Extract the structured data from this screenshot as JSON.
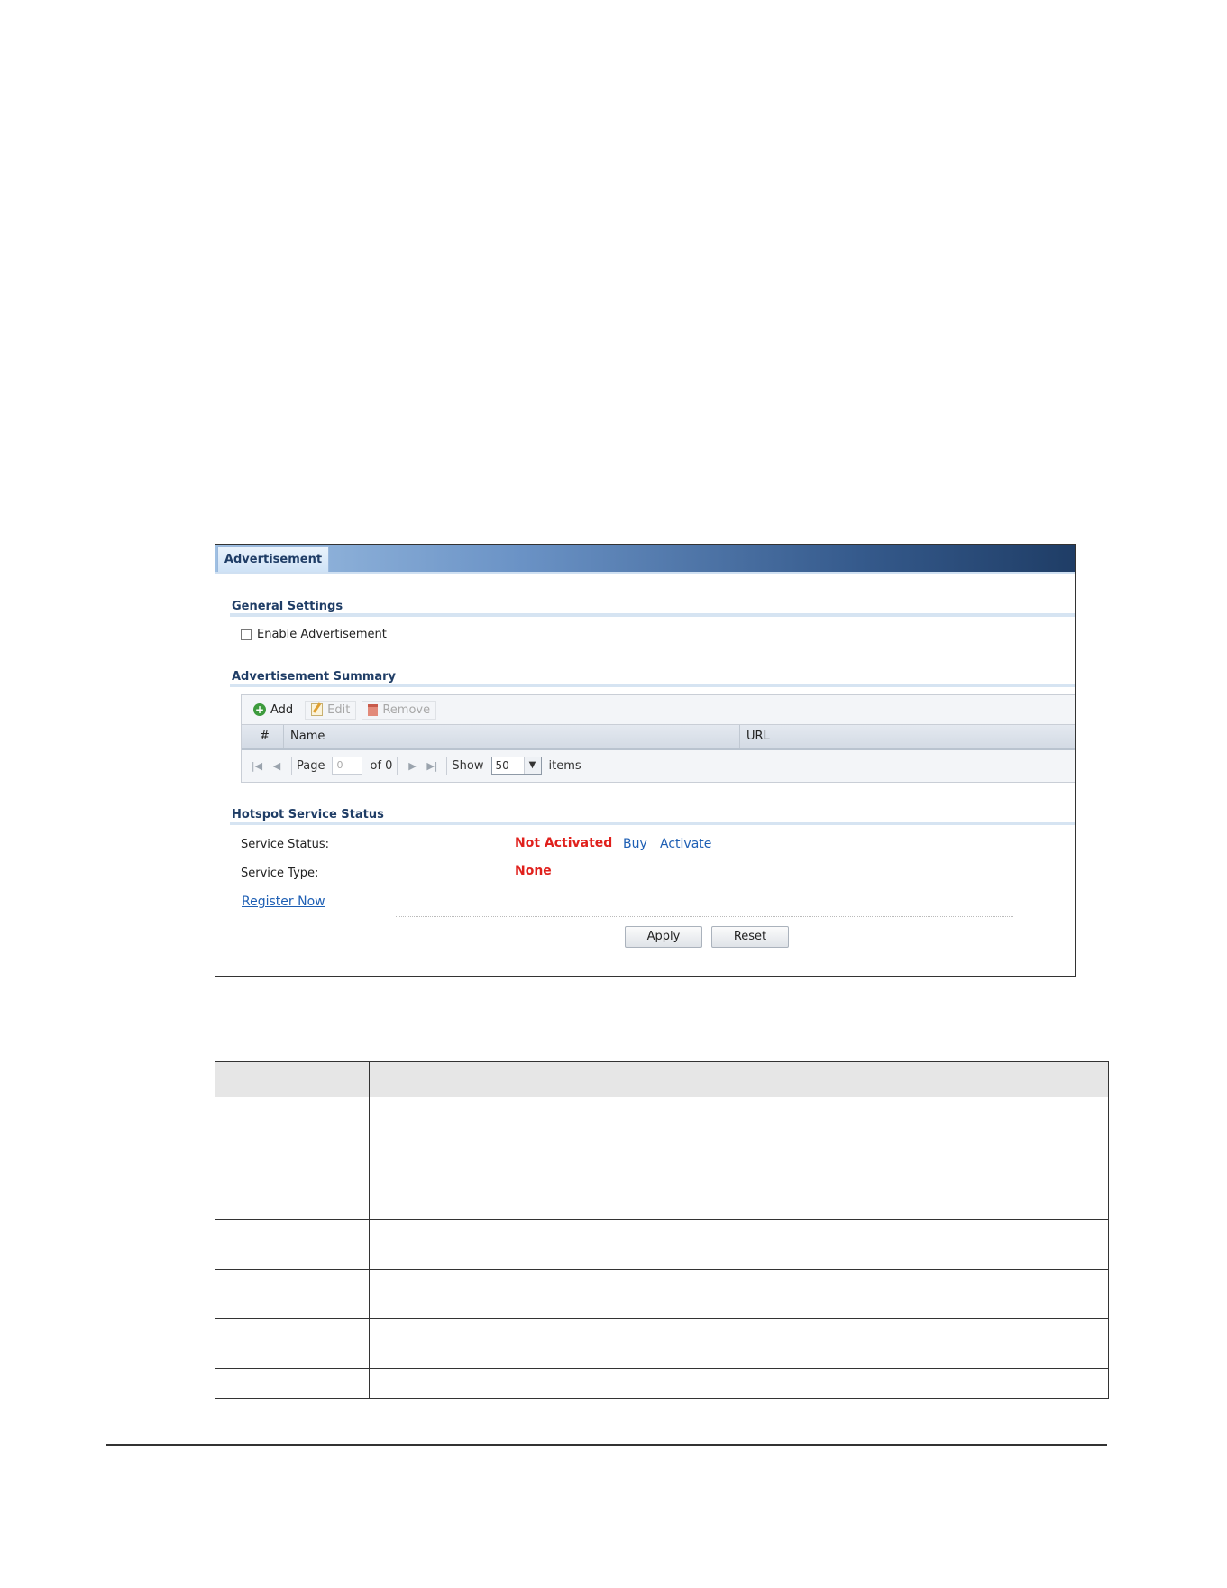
{
  "screenshot": {
    "tab": "Advertisement",
    "general_settings": {
      "title": "General Settings",
      "enable_label": "Enable Advertisement"
    },
    "summary": {
      "title": "Advertisement Summary",
      "toolbar": {
        "add": "Add",
        "edit": "Edit",
        "remove": "Remove"
      },
      "columns": {
        "num": "#",
        "name": "Name",
        "url": "URL"
      },
      "pager": {
        "page_label": "Page",
        "page_value": "0",
        "of_label": "of 0",
        "show_label": "Show",
        "show_value": "50",
        "items_label": "items"
      }
    },
    "hotspot": {
      "title": "Hotspot Service Status",
      "service_status_label": "Service Status:",
      "service_status_value": "Not Activated",
      "buy": "Buy",
      "activate": "Activate",
      "service_type_label": "Service Type:",
      "service_type_value": "None",
      "register": "Register Now"
    },
    "buttons": {
      "apply": "Apply",
      "reset": "Reset"
    }
  },
  "colors": {
    "status_red": "#e0201c",
    "link_blue": "#1e5fb4",
    "heading_navy": "#1f3d66"
  }
}
